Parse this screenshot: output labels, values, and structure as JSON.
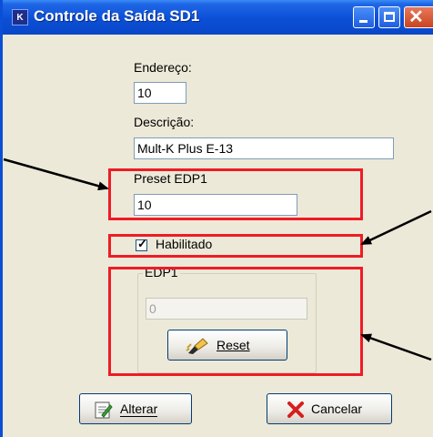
{
  "window": {
    "title": "Controle da Saída SD1",
    "app_icon_glyph": "K",
    "accent_color": "#0b4fd6",
    "highlight_color": "#ee1c25"
  },
  "form": {
    "endereco_label": "Endereço:",
    "endereco_value": "10",
    "descricao_label": "Descrição:",
    "descricao_value": "Mult-K Plus E-13",
    "preset_label": "Preset EDP1",
    "preset_value": "10",
    "habilitado_label": "Habilitado",
    "habilitado_checked": true,
    "group_title": "EDP1",
    "edp1_value": "0"
  },
  "buttons": {
    "reset_label": "Reset",
    "alterar_label": "Alterar",
    "cancelar_label": "Cancelar"
  }
}
